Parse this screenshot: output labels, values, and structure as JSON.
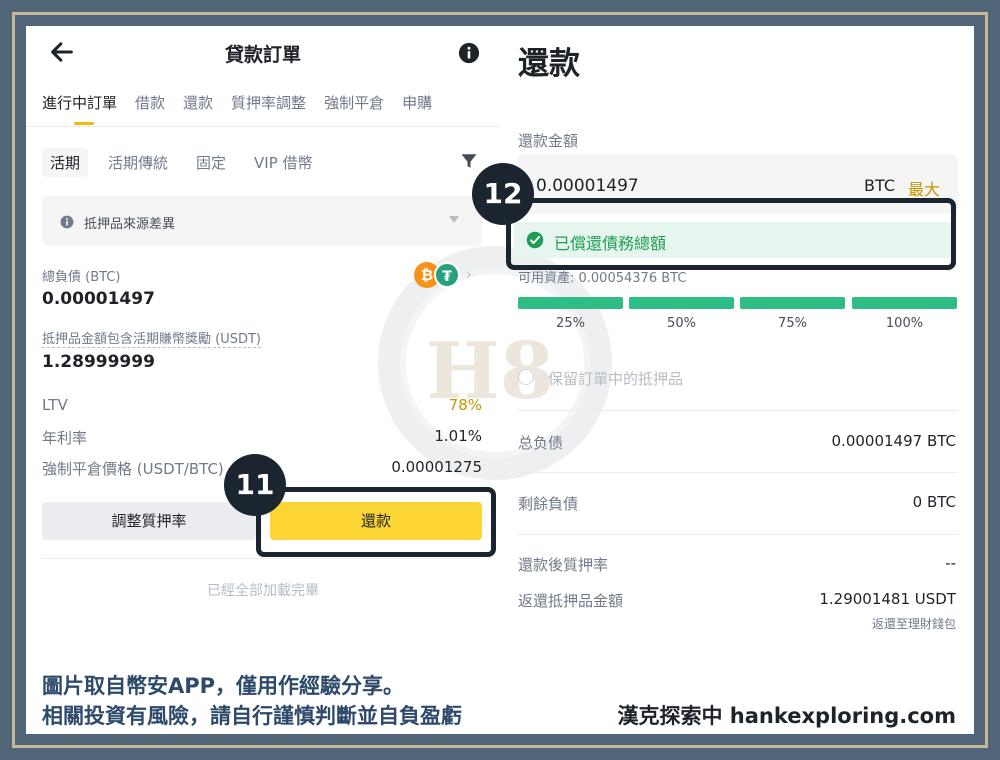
{
  "left": {
    "header_title": "貸款訂單",
    "tabs": [
      "進行中訂單",
      "借款",
      "還款",
      "質押率調整",
      "強制平倉",
      "申購"
    ],
    "subtabs": [
      "活期",
      "活期傳統",
      "固定",
      "VIP 借幣"
    ],
    "source_label": "抵押品來源差異",
    "total_debt_label": "總負債 (BTC)",
    "total_debt_value": "0.00001497",
    "collateral_label": "抵押品金額包含活期賺幣獎勵 (USDT)",
    "collateral_value": "1.28999999",
    "coin_btc_glyph": "₿",
    "coin_usdt_glyph": "₮",
    "rows": [
      {
        "label": "LTV",
        "value": "78%"
      },
      {
        "label": "年利率",
        "value": "1.01%"
      },
      {
        "label": "強制平倉價格 (USDT/BTC)",
        "value": "0.00001275"
      }
    ],
    "adjust_button": "調整質押率",
    "repay_button": "還款",
    "all_loaded": "已經全部加載完畢",
    "badge": "11"
  },
  "right": {
    "title": "還款",
    "amount_label": "還款金額",
    "amount_value": "0.00001497",
    "amount_unit": "BTC",
    "amount_max": "最大",
    "paid_text": "已償還債務總額",
    "available_text": "可用資產: 0.00054376 BTC",
    "percents": [
      "25%",
      "50%",
      "75%",
      "100%"
    ],
    "keep_collateral": "保留訂單中的抵押品",
    "rows": [
      {
        "label": "总负债",
        "value": "0.00001497 BTC"
      },
      {
        "label": "剩餘負債",
        "value": "0 BTC"
      },
      {
        "label": "還款後質押率",
        "value": "--"
      },
      {
        "label": "返還抵押品金額",
        "value": "1.29001481 USDT"
      }
    ],
    "return_note": "返還至理財錢包",
    "badge": "12"
  },
  "watermark": "H8",
  "captions": {
    "line1": "圖片取自幣安APP，僅用作經驗分享。",
    "line2": "相關投資有風險，請自行謹慎判斷並自負盈虧",
    "brand": "漢克探索中 hankexploring.com"
  },
  "colors": {
    "accent_yellow": "#fcd535",
    "brand_gold": "#f0b90b",
    "success_green": "#2ebd85",
    "frame_blue": "#52667a"
  }
}
